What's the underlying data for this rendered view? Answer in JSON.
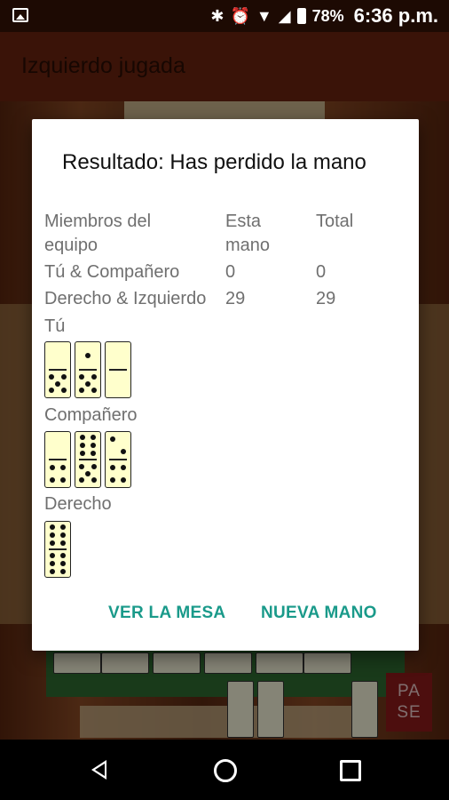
{
  "status_bar": {
    "battery": "78%",
    "time": "6:36 p.m."
  },
  "app_bar": {
    "title": "Izquierdo jugada"
  },
  "dialog": {
    "title": "Resultado: Has perdido la mano",
    "headers": {
      "members": "Miembros del equipo",
      "this_hand": "Esta mano",
      "total": "Total"
    },
    "rows": [
      {
        "team": "Tú & Compañero",
        "this_hand": "0",
        "total": "0"
      },
      {
        "team": "Derecho & Izquierdo",
        "this_hand": "29",
        "total": "29"
      }
    ],
    "hands": [
      {
        "player": "Tú",
        "tiles": [
          [
            0,
            5
          ],
          [
            1,
            5
          ],
          [
            0,
            0
          ]
        ]
      },
      {
        "player": "Compañero",
        "tiles": [
          [
            0,
            4
          ],
          [
            6,
            5
          ],
          [
            2,
            4
          ]
        ]
      },
      {
        "player": "Derecho",
        "tiles": [
          [
            6,
            6
          ]
        ]
      }
    ],
    "buttons": {
      "view_table": "VER LA MESA",
      "new_hand": "NUEVA MANO"
    }
  },
  "game": {
    "pass_button": "PA SE"
  },
  "colors": {
    "accent": "#1a9a8a",
    "app_bar": "#6a2410",
    "tile": "#ffffcc"
  }
}
